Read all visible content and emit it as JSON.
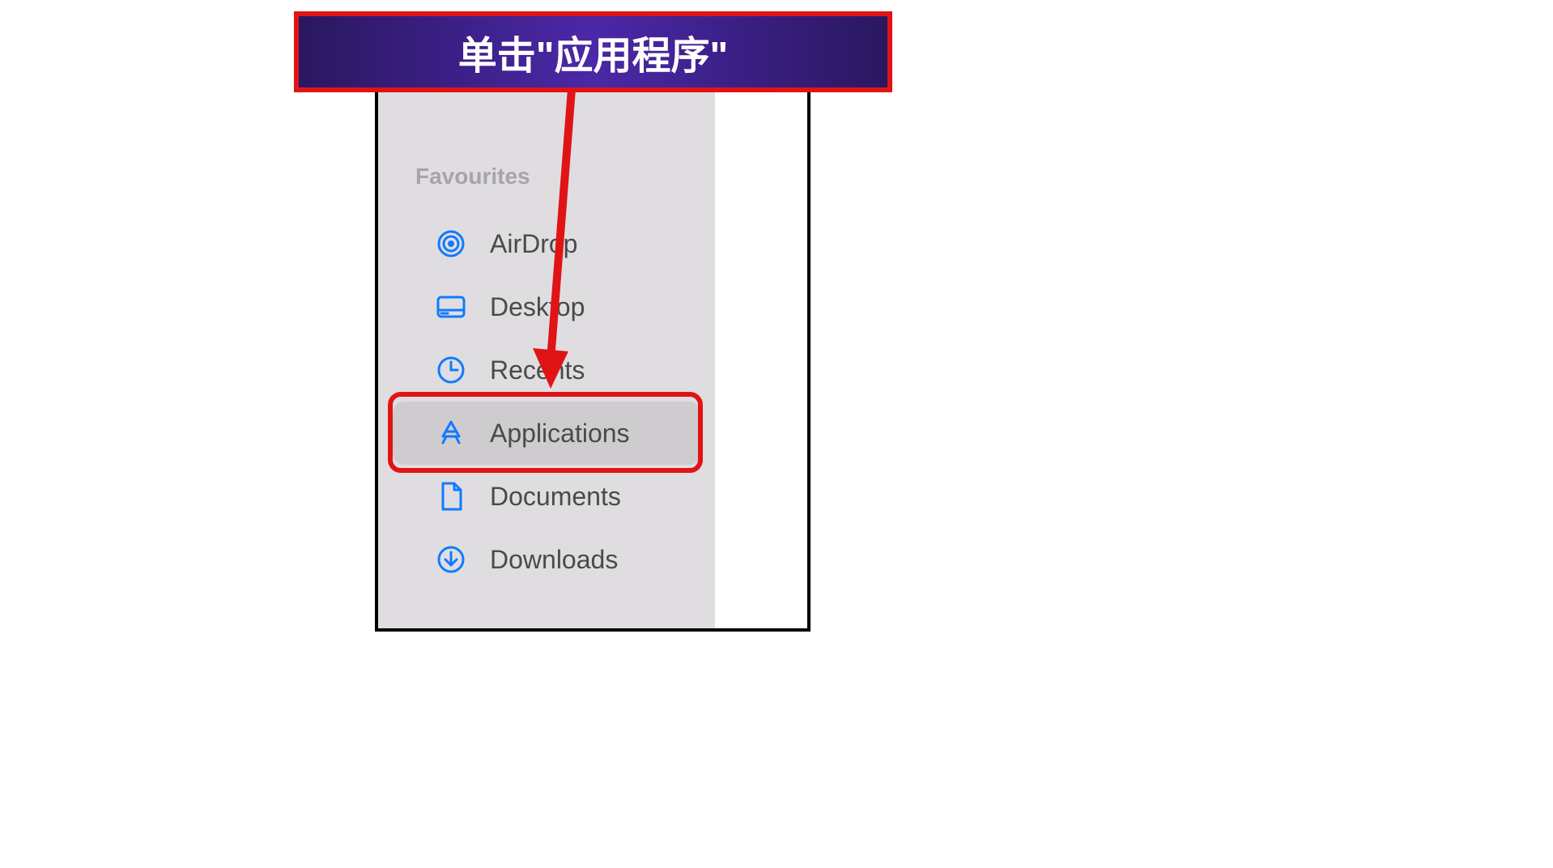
{
  "callout": {
    "text": "单击\"应用程序\""
  },
  "sidebar": {
    "section_heading": "Favourites",
    "items": [
      {
        "label": "AirDrop",
        "icon": "airdrop-icon",
        "selected": false
      },
      {
        "label": "Desktop",
        "icon": "desktop-icon",
        "selected": false
      },
      {
        "label": "Recents",
        "icon": "recents-icon",
        "selected": false
      },
      {
        "label": "Applications",
        "icon": "applications-icon",
        "selected": true
      },
      {
        "label": "Documents",
        "icon": "documents-icon",
        "selected": false
      },
      {
        "label": "Downloads",
        "icon": "downloads-icon",
        "selected": false
      }
    ]
  },
  "colors": {
    "callout_border": "#e01414",
    "callout_bg_start": "#2a1760",
    "callout_bg_mid": "#4b28a8",
    "sidebar_bg": "#e0dde1",
    "icon_blue": "#0f7bff"
  }
}
